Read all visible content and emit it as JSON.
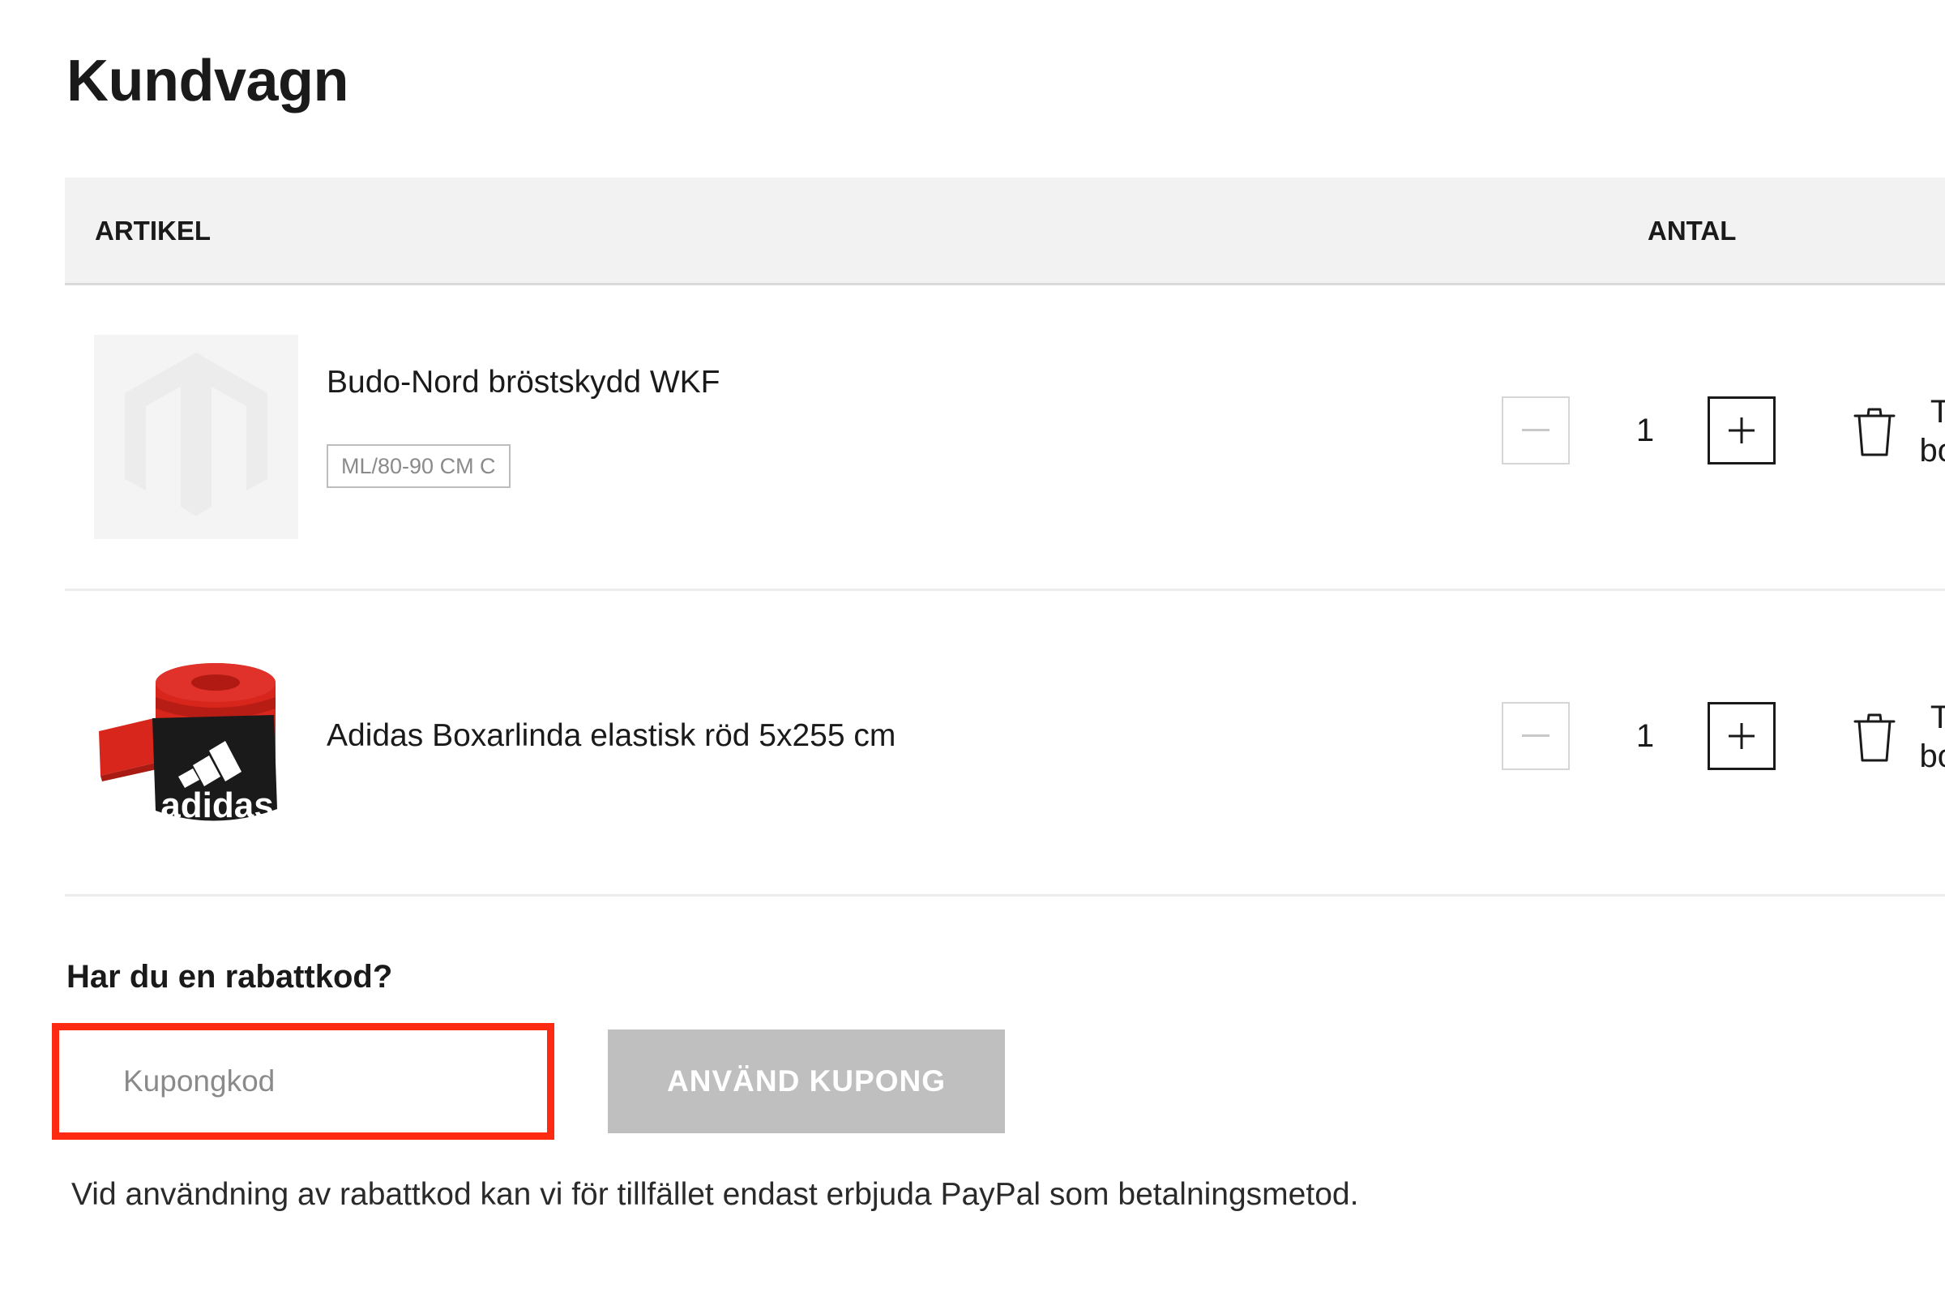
{
  "page": {
    "title": "Kundvagn"
  },
  "table": {
    "headers": {
      "article": "ARTIKEL",
      "quantity": "ANTAL"
    }
  },
  "cart": {
    "items": [
      {
        "name": "Budo-Nord bröstskydd WKF",
        "option": "ML/80-90 CM C",
        "quantity": "1",
        "remove_label": "Ta bort",
        "image": "placeholder-logo"
      },
      {
        "name": "Adidas Boxarlinda elastisk röd 5x255 cm",
        "quantity": "1",
        "remove_label": "Ta bort",
        "image": "red-boxing-hand-wrap",
        "image_brand_text": "adidas"
      }
    ]
  },
  "coupon": {
    "heading": "Har du en rabattkod?",
    "input_value": "",
    "input_placeholder": "Kupongkod",
    "apply_label": "ANVÄND KUPONG",
    "note": "Vid användning av rabattkod kan vi för tillfället endast erbjuda PayPal som betalningsmetod."
  },
  "icons": {
    "decrease": "minus-icon",
    "increase": "plus-icon",
    "remove": "trash-icon"
  },
  "colors": {
    "highlight": "#ff2a12",
    "header_bg": "#f2f2f2",
    "disabled_button": "#bfbfbf"
  }
}
